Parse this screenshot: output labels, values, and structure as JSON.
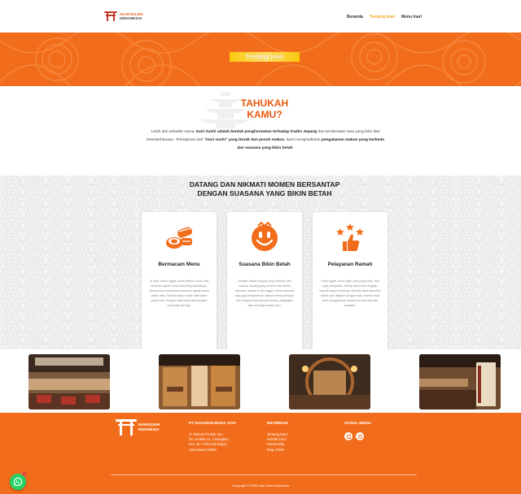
{
  "nav": {
    "logo_line1": "INARISUSHI",
    "logo_line2": "INDONESIA",
    "items": [
      {
        "label": "Beranda"
      },
      {
        "label": "Tentang Inari"
      },
      {
        "label": "Menu Inari"
      }
    ],
    "active_color": "#f5a623"
  },
  "hero": {
    "title": "Tentang Inari",
    "bg_color": "#f26d1b"
  },
  "intro": {
    "heading_line1": "TAHUKAH",
    "heading_line2": "KAMU?",
    "p_a": "Lebih dari sekadar nama, ",
    "p_b": "Inari Sushi adalah bentuk penghormatan terhadap tradisi Jepang",
    "p_c": " dan kenikmatan rasa yang lahir dari kesederhanaan. Terinspirasi dari ",
    "p_d": "\"inari sushi\" yang ikonik dan penuh makna",
    "p_e": ", kami menghadirkan ",
    "p_f": "pengalaman makan yang berbeda dan suasana yang bikin betah",
    "p_g": "."
  },
  "features": {
    "heading_line1": "DATANG DAN NIKMATI MOMEN BERSANTAP",
    "heading_line2": "DENGAN SUASANA YANG BIKIN BETAH",
    "cards": [
      {
        "icon": "sushi-icon",
        "title": "Bermacam Menu",
        "desc": "Di Inari, kamu nggak cuma ketemu sushi, kita beneran ngasih menu fast yang spesialnya. Jamas bisa masing kali menemui ngasih kamu makin rasa. Semua kamu masih niat bahan yang fresh, dengan rasa yang bikin pengen coba lagi dan lagi."
      },
      {
        "icon": "smiley-icon",
        "title": "Suasana Bikin Betah",
        "desc": "Dengan desain tempat yang kekinian dan nuansa Jepang yang modern dan minim dekorasi, makan di sini nggak cuma soal rasa tapi juga pengalaman. Mama meetup tempat dan hangout bareng kami teman, pasangan, atau keluarga makin seru."
      },
      {
        "icon": "rating-icon",
        "title": "Pelayanan Ramah",
        "desc": "Kami nggak cuma sajiin rasa yang enak, tapi juga pelayanan. Setiap tamu kami anggap seperti bagian keluarga. Mereka kami disambut ramah dan dilayani dengan baik. Karena buat kami, pengalaman makan itu soal rasa dan suasana."
      }
    ]
  },
  "photos": [
    {
      "alt": "restaurant-photo-1"
    },
    {
      "alt": "restaurant-photo-2"
    },
    {
      "alt": "restaurant-photo-3"
    },
    {
      "alt": "restaurant-photo-4"
    }
  ],
  "footer": {
    "logo_line1": "INARISUSHI",
    "logo_line2": "INDONESIA",
    "company": {
      "heading": "PT NASAMAN BOGA JAYA",
      "lines": [
        "Jl. Wisma Pondok Ayu",
        "No 10 Blok A1, Cisangkan,",
        "Kec. Bn. Pulo Kab Bogor,",
        "Jawa Barat 16930"
      ]
    },
    "info": {
      "heading": "INFORMASI",
      "links": [
        "Tentang Kami",
        "Kontak Kami",
        "Partnership",
        "Blog Artikel"
      ]
    },
    "social": {
      "heading": "SOSIAL MEDIA",
      "icons": [
        "instagram-icon",
        "tiktok-icon"
      ]
    },
    "copyright": "Copyright © 2025 Inari Sushi Indonesia",
    "bg_color": "#f26d1b"
  }
}
